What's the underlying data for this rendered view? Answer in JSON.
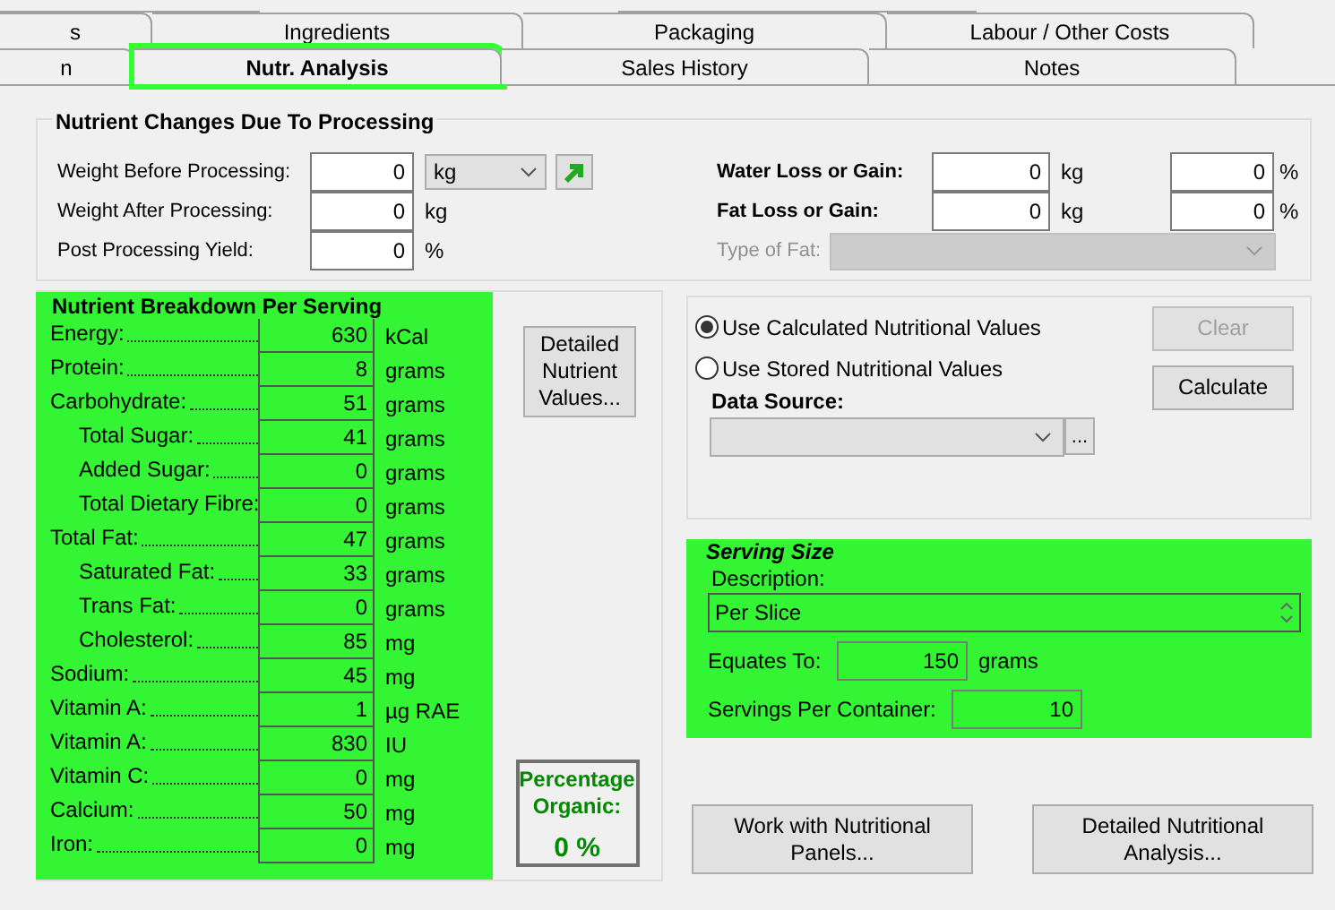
{
  "tabs_top": [
    {
      "label": "s",
      "selected": false,
      "highlighted": false
    },
    {
      "label": "Ingredients",
      "selected": false,
      "highlighted": false
    },
    {
      "label": "Packaging",
      "selected": false,
      "highlighted": false
    },
    {
      "label": "Labour / Other Costs",
      "selected": false,
      "highlighted": false
    }
  ],
  "tabs_bottom": [
    {
      "label": "n",
      "selected": false,
      "highlighted": false
    },
    {
      "label": "Nutr. Analysis",
      "selected": true,
      "highlighted": true
    },
    {
      "label": "Sales History",
      "selected": false,
      "highlighted": false
    },
    {
      "label": "Notes",
      "selected": false,
      "highlighted": false
    }
  ],
  "processing": {
    "title": "Nutrient Changes Due To Processing",
    "weight_before": {
      "label": "Weight Before Processing:",
      "value": "0",
      "unit": "kg"
    },
    "weight_after": {
      "label": "Weight After Processing:",
      "value": "0",
      "unit": "kg"
    },
    "yield": {
      "label": "Post Processing Yield:",
      "value": "0",
      "unit": "%"
    },
    "water": {
      "label": "Water Loss or Gain:",
      "value": "0",
      "unit": "kg",
      "percent": "0",
      "percent_unit": "%"
    },
    "fat": {
      "label": "Fat Loss or Gain:",
      "value": "0",
      "unit": "kg",
      "percent": "0",
      "percent_unit": "%"
    },
    "type_of_fat": {
      "label": "Type of Fat:",
      "disabled": true
    }
  },
  "nutrient_breakdown": {
    "title": "Nutrient Breakdown Per Serving",
    "highlighted": true,
    "rows": [
      {
        "label": "Energy:",
        "value": "630",
        "unit": "kCal"
      },
      {
        "label": "Protein:",
        "value": "8",
        "unit": "grams"
      },
      {
        "label": "Carbohydrate:",
        "value": "51",
        "unit": "grams",
        "children": [
          {
            "label": "Total Sugar:",
            "value": "41",
            "unit": "grams"
          },
          {
            "label": "Added Sugar:",
            "value": "0",
            "unit": "grams"
          },
          {
            "label": "Total Dietary Fibre:",
            "value": "0",
            "unit": "grams"
          }
        ]
      },
      {
        "label": "Total Fat:",
        "value": "47",
        "unit": "grams",
        "children": [
          {
            "label": "Saturated Fat:",
            "value": "33",
            "unit": "grams"
          },
          {
            "label": "Trans Fat:",
            "value": "0",
            "unit": "grams"
          },
          {
            "label": "Cholesterol:",
            "value": "85",
            "unit": "mg"
          }
        ]
      },
      {
        "label": "Sodium:",
        "value": "45",
        "unit": "mg"
      },
      {
        "label": "Vitamin A:",
        "value": "1",
        "unit": "µg RAE"
      },
      {
        "label": "Vitamin A:",
        "value": "830",
        "unit": "IU"
      },
      {
        "label": "Vitamin C:",
        "value": "0",
        "unit": "mg"
      },
      {
        "label": "Calcium:",
        "value": "50",
        "unit": "mg"
      },
      {
        "label": "Iron:",
        "value": "0",
        "unit": "mg"
      }
    ]
  },
  "detailed_nutrient_button": "Detailed Nutrient Values...",
  "organic": {
    "label": "Percentage Organic:",
    "value": "0 %"
  },
  "source": {
    "options": [
      {
        "label": "Use Calculated Nutritional Values",
        "selected": true
      },
      {
        "label": "Use Stored Nutritional Values",
        "selected": false
      }
    ],
    "data_source_label": "Data Source:",
    "browse_button": "...",
    "clear_button": {
      "label": "Clear",
      "disabled": true
    },
    "calculate_button": {
      "label": "Calculate",
      "disabled": false
    }
  },
  "serving_size": {
    "title": "Serving Size",
    "highlighted": true,
    "description_label": "Description:",
    "description": "Per Slice",
    "equates_label": "Equates To:",
    "equates_value": "150",
    "equates_unit": "grams",
    "servings_label": "Servings Per Container:",
    "servings_value": "10"
  },
  "bottom_buttons": [
    "Work with Nutritional Panels...",
    "Detailed Nutritional Analysis..."
  ]
}
